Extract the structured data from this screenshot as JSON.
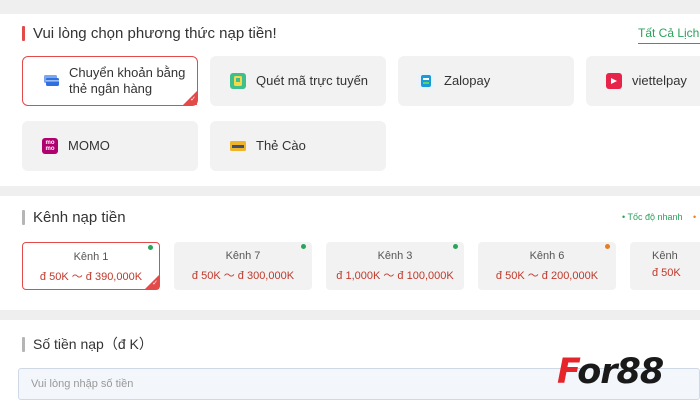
{
  "method_section": {
    "title": "Vui lòng chọn phương thức nạp tiền!",
    "history_link": "Tất Cả Lịch Sử",
    "methods": [
      {
        "label": "Chuyển khoản bằng thẻ ngân hàng",
        "icon": "bank-card-icon",
        "selected": true
      },
      {
        "label": "Quét mã trực tuyến",
        "icon": "qr-scan-icon",
        "selected": false
      },
      {
        "label": "Zalopay",
        "icon": "zalopay-icon",
        "selected": false
      },
      {
        "label": "viettelpay",
        "icon": "viettelpay-icon",
        "selected": false
      },
      {
        "label": "MOMO",
        "icon": "momo-icon",
        "selected": false
      },
      {
        "label": "Thẻ Cào",
        "icon": "scratch-card-icon",
        "selected": false
      }
    ]
  },
  "channel_section": {
    "title": "Kênh nạp tiền",
    "legend_fast": "• Tốc độ nhanh",
    "legend_other": "•",
    "channels": [
      {
        "name": "Kênh 1",
        "range": "đ 50K ～ đ 390,000K",
        "status_color": "#2aa35b",
        "selected": true
      },
      {
        "name": "Kênh 7",
        "range": "đ 50K ～ đ 300,000K",
        "status_color": "#2aa35b",
        "selected": false
      },
      {
        "name": "Kênh 3",
        "range": "đ 1,000K ～ đ 100,000K",
        "status_color": "#2aa35b",
        "selected": false
      },
      {
        "name": "Kênh 6",
        "range": "đ 50K ～ đ 200,000K",
        "status_color": "#e67e22",
        "selected": false
      },
      {
        "name": "Kênh",
        "range": "đ 50K",
        "status_color": "#2aa35b",
        "selected": false
      }
    ]
  },
  "amount_section": {
    "title": "Số tiền nạp（đ K）",
    "placeholder": "Vui lòng nhập số tiền",
    "value": ""
  },
  "watermark": {
    "first": "F",
    "rest": "or88"
  },
  "colors": {
    "accent": "#e34a4a",
    "green": "#2aa35b",
    "orange": "#e67e22"
  }
}
